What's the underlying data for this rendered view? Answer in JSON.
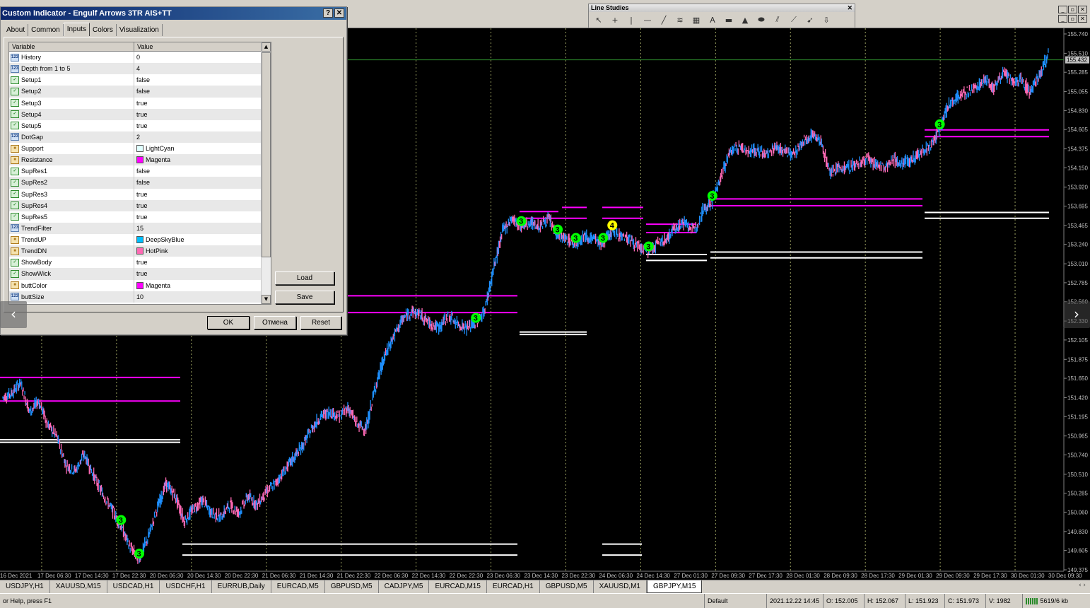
{
  "dialog": {
    "title": "Custom Indicator - Engulf Arrows 3TR AIS+TT",
    "help_btn": "?",
    "close_btn": "✕",
    "tabs": [
      "About",
      "Common",
      "Inputs",
      "Colors",
      "Visualization"
    ],
    "active_tab": "Inputs",
    "grid_headers": {
      "variable": "Variable",
      "value": "Value"
    },
    "params": [
      {
        "name": "History",
        "value": "0",
        "kind": "int"
      },
      {
        "name": "Depth from 1 to 5",
        "value": "4",
        "kind": "int"
      },
      {
        "name": "Setup1",
        "value": "false",
        "kind": "bool"
      },
      {
        "name": "Setup2",
        "value": "false",
        "kind": "bool"
      },
      {
        "name": "Setup3",
        "value": "true",
        "kind": "bool"
      },
      {
        "name": "Setup4",
        "value": "true",
        "kind": "bool"
      },
      {
        "name": "Setup5",
        "value": "true",
        "kind": "bool"
      },
      {
        "name": "DotGap",
        "value": "2",
        "kind": "int"
      },
      {
        "name": "Support",
        "value": "LightCyan",
        "kind": "color",
        "color": "#e0ffff"
      },
      {
        "name": "Resistance",
        "value": "Magenta",
        "kind": "color",
        "color": "#ff00ff"
      },
      {
        "name": "SupRes1",
        "value": "false",
        "kind": "bool"
      },
      {
        "name": "SupRes2",
        "value": "false",
        "kind": "bool"
      },
      {
        "name": "SupRes3",
        "value": "true",
        "kind": "bool"
      },
      {
        "name": "SupRes4",
        "value": "true",
        "kind": "bool"
      },
      {
        "name": "SupRes5",
        "value": "true",
        "kind": "bool"
      },
      {
        "name": "TrendFilter",
        "value": "15",
        "kind": "int"
      },
      {
        "name": "TrendUP",
        "value": "DeepSkyBlue",
        "kind": "color",
        "color": "#00bfff"
      },
      {
        "name": "TrendDN",
        "value": "HotPink",
        "kind": "color",
        "color": "#ff69b4"
      },
      {
        "name": "ShowBody",
        "value": "true",
        "kind": "bool"
      },
      {
        "name": "ShowWick",
        "value": "true",
        "kind": "bool"
      },
      {
        "name": "buttColor",
        "value": "Magenta",
        "kind": "color",
        "color": "#ff00ff"
      },
      {
        "name": "buttSize",
        "value": "10",
        "kind": "int"
      }
    ],
    "kind_icons": {
      "int": "123",
      "bool": "✓",
      "color": "■"
    },
    "buttons": {
      "load": "Load",
      "save": "Save",
      "ok": "OK",
      "cancel": "Отмена",
      "reset": "Reset"
    }
  },
  "line_studies": {
    "title": "Line Studies",
    "close": "✕",
    "tools": [
      "cursor-icon",
      "crosshair-icon",
      "vertical-line-icon",
      "horizontal-line-icon",
      "trendline-icon",
      "fibo-icon",
      "channel-icon",
      "text-icon",
      "rectangle-icon",
      "triangle-icon",
      "ellipse-icon",
      "pitchfork-icon",
      "gann-icon",
      "arrow-icon",
      "more-icon"
    ],
    "tool_glyphs": [
      "↖",
      "+",
      "|",
      "—",
      "╱",
      "≋",
      "▦",
      "A",
      "▬",
      "▲",
      "⬬",
      "⫽",
      "⟋",
      "➹",
      "⇩"
    ]
  },
  "mdi_buttons": [
    "_",
    "▫",
    "✕"
  ],
  "chart_data": {
    "type": "line",
    "symbol": "GBPJPY,M15",
    "current_price": "155.432",
    "price_labels": [
      "155.740",
      "155.510",
      "155.285",
      "155.055",
      "154.830",
      "154.605",
      "154.375",
      "154.150",
      "153.920",
      "153.695",
      "153.465",
      "153.240",
      "153.010",
      "152.785",
      "152.560",
      "152.330",
      "152.105",
      "151.875",
      "151.650",
      "151.420",
      "151.195",
      "150.965",
      "150.740",
      "150.510",
      "150.285",
      "150.060",
      "149.830",
      "149.605",
      "149.375"
    ],
    "time_labels": [
      "16 Dec 2021",
      "17 Dec 06:30",
      "17 Dec 14:30",
      "17 Dec 22:30",
      "20 Dec 06:30",
      "20 Dec 14:30",
      "20 Dec 22:30",
      "21 Dec 06:30",
      "21 Dec 14:30",
      "21 Dec 22:30",
      "22 Dec 06:30",
      "22 Dec 14:30",
      "22 Dec 22:30",
      "23 Dec 06:30",
      "23 Dec 14:30",
      "23 Dec 22:30",
      "24 Dec 06:30",
      "24 Dec 14:30",
      "27 Dec 01:30",
      "27 Dec 09:30",
      "27 Dec 17:30",
      "28 Dec 01:30",
      "28 Dec 09:30",
      "28 Dec 17:30",
      "29 Dec 01:30",
      "29 Dec 09:30",
      "29 Dec 17:30",
      "30 Dec 01:30",
      "30 Dec 09:30"
    ],
    "ylim": [
      149.375,
      155.74
    ],
    "price_path": [
      151.42,
      151.47,
      151.6,
      151.25,
      151.38,
      151.1,
      150.95,
      150.62,
      150.55,
      150.75,
      150.5,
      150.28,
      150.1,
      149.9,
      149.65,
      149.5,
      149.75,
      150.1,
      150.4,
      150.25,
      149.95,
      150.1,
      150.2,
      150.05,
      150.0,
      150.15,
      150.05,
      150.25,
      150.15,
      150.3,
      150.4,
      150.55,
      150.7,
      150.85,
      151.05,
      151.2,
      151.25,
      151.2,
      151.3,
      151.1,
      151.05,
      151.55,
      151.9,
      152.15,
      152.35,
      152.45,
      152.4,
      152.3,
      152.25,
      152.4,
      152.3,
      152.25,
      152.3,
      152.45,
      152.95,
      153.4,
      153.55,
      153.45,
      153.5,
      153.45,
      153.55,
      153.35,
      153.3,
      153.25,
      153.35,
      153.3,
      153.25,
      153.4,
      153.35,
      153.3,
      153.2,
      153.15,
      153.25,
      153.3,
      153.45,
      153.5,
      153.4,
      153.65,
      153.75,
      154.05,
      154.35,
      154.4,
      154.35,
      154.35,
      154.3,
      154.4,
      154.35,
      154.3,
      154.45,
      154.55,
      154.45,
      154.1,
      154.15,
      154.15,
      154.2,
      154.25,
      154.2,
      154.15,
      154.25,
      154.2,
      154.25,
      154.35,
      154.4,
      154.6,
      154.9,
      155.0,
      155.05,
      155.1,
      155.2,
      155.1,
      155.3,
      155.15,
      155.2,
      155.05,
      155.25,
      155.5
    ],
    "markers": [
      {
        "label": "3",
        "x_index": 13,
        "color": "#00ff00"
      },
      {
        "label": "3",
        "x_index": 15,
        "color": "#00ff00"
      },
      {
        "label": "3",
        "x_index": 52,
        "color": "#00ff00"
      },
      {
        "label": "3",
        "x_index": 57,
        "color": "#00ff00"
      },
      {
        "label": "3",
        "x_index": 61,
        "color": "#00ff00"
      },
      {
        "label": "3",
        "x_index": 63,
        "color": "#00ff00"
      },
      {
        "label": "3",
        "x_index": 66,
        "color": "#00ff00"
      },
      {
        "label": "4",
        "x_index": 67,
        "color": "#ffff00"
      },
      {
        "label": "3",
        "x_index": 71,
        "color": "#00ff00"
      },
      {
        "label": "3",
        "x_index": 78,
        "color": "#00ff00"
      },
      {
        "label": "3",
        "x_index": 103,
        "color": "#00ff00"
      }
    ],
    "resistance_color": "#ff00ff",
    "support_color": "#ffffff",
    "up_color": "#1e90ff",
    "down_color": "#ff69b4",
    "grid": true
  },
  "symbol_tabs": [
    "USDJPY,H1",
    "XAUUSD,M15",
    "USDCAD,H1",
    "USDCHF,H1",
    "EURRUB,Daily",
    "EURCAD,M5",
    "GBPUSD,M5",
    "CADJPY,M5",
    "EURCAD,M15",
    "EURCAD,H1",
    "GBPUSD,M5",
    "XAUUSD,M1",
    "GBPJPY,M15"
  ],
  "active_symbol_index": 12,
  "symbol_nav": "‹ ›",
  "status": {
    "help": "or Help, press F1",
    "profile": "Default",
    "datetime": "2021.12.22 14:45",
    "open": "O: 152.005",
    "high": "H: 152.067",
    "low": "L: 151.923",
    "close": "C: 151.973",
    "volume": "V: 1982",
    "traffic": "5619/6 kb"
  },
  "nav": {
    "left": "‹",
    "right": "›"
  }
}
